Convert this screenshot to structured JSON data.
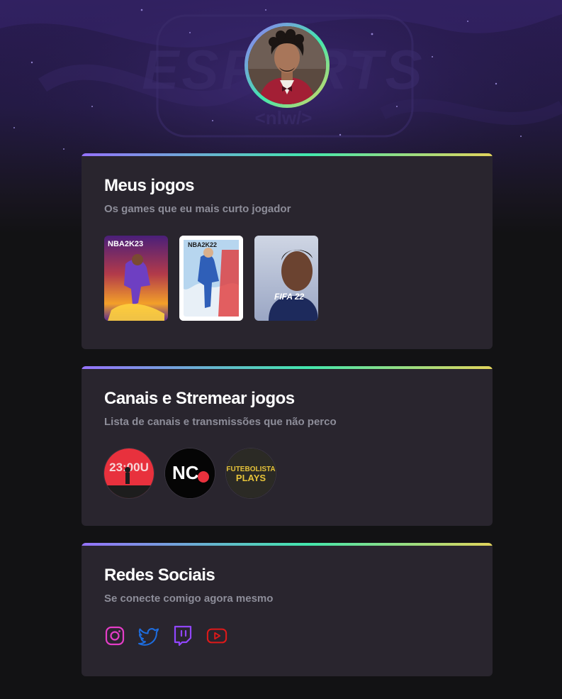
{
  "profile": {
    "avatar_alt": "Foto de perfil"
  },
  "sections": {
    "games": {
      "title": "Meus jogos",
      "subtitle": "Os games que eu mais curto jogador",
      "items": [
        {
          "label": "NBA2K23"
        },
        {
          "label": "NBA2K22"
        },
        {
          "label": "FIFA 22"
        }
      ]
    },
    "channels": {
      "title": "Canais e Stremear jogos",
      "subtitle": "Lista de canais e transmissões que não perco",
      "items": [
        {
          "label": "23:00U"
        },
        {
          "label": "NC"
        },
        {
          "label_line1": "FUTEBOLISTA",
          "label_line2": "PLAYS"
        }
      ]
    },
    "social": {
      "title": "Redes Sociais",
      "subtitle": "Se conecte comigo agora mesmo",
      "items": [
        {
          "icon": "instagram-icon",
          "color": "#E43DC7"
        },
        {
          "icon": "twitter-icon",
          "color": "#1D6DE0"
        },
        {
          "icon": "twitch-icon",
          "color": "#9146FF"
        },
        {
          "icon": "youtube-icon",
          "color": "#E01919"
        }
      ]
    }
  },
  "background": {
    "logo_text": "ESPORTS",
    "logo_sub": "<nlw/>"
  }
}
